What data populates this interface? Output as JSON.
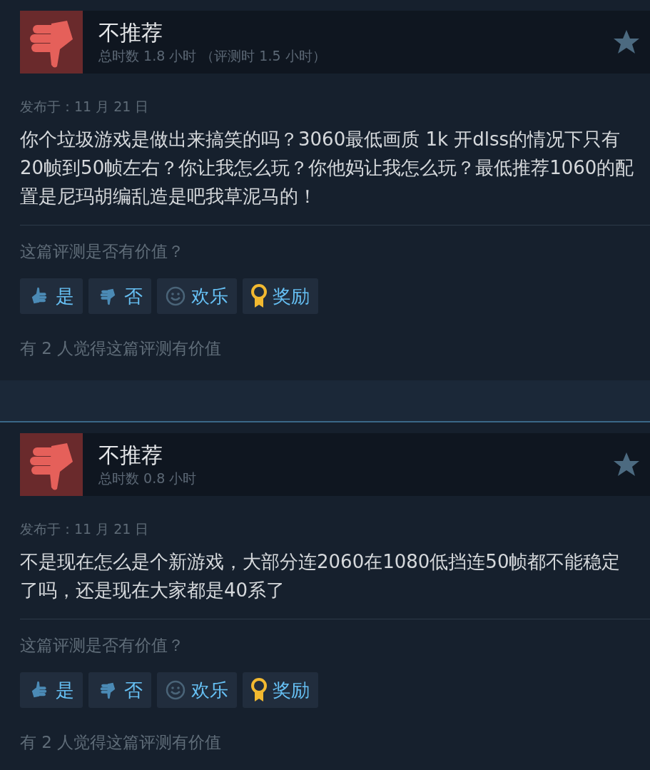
{
  "reviews": [
    {
      "recommended": false,
      "title": "不推荐",
      "hours": "总时数 1.8 小时 （评测时 1.5 小时）",
      "date": "发布于：11 月 21 日",
      "body": "你个垃圾游戏是做出来搞笑的吗？3060最低画质 1k 开dlss的情况下只有20帧到50帧左右？你让我怎么玩？你他妈让我怎么玩？最低推荐1060的配置是尼玛胡编乱造是吧我草泥马的！",
      "question": "这篇评测是否有价值？",
      "buttons": [
        {
          "kind": "yes",
          "label": "是"
        },
        {
          "kind": "no",
          "label": "否"
        },
        {
          "kind": "funny",
          "label": "欢乐"
        },
        {
          "kind": "award",
          "label": "奖励"
        }
      ],
      "helpful": "有 2 人觉得这篇评测有价值"
    },
    {
      "recommended": false,
      "title": "不推荐",
      "hours": "总时数 0.8 小时",
      "date": "发布于：11 月 21 日",
      "body": "不是现在怎么是个新游戏，大部分连2060在1080低挡连50帧都不能稳定了吗，还是现在大家都是40系了",
      "question": "这篇评测是否有价值？",
      "buttons": [
        {
          "kind": "yes",
          "label": "是"
        },
        {
          "kind": "no",
          "label": "否"
        },
        {
          "kind": "funny",
          "label": "欢乐"
        },
        {
          "kind": "award",
          "label": "奖励"
        }
      ],
      "helpful": "有 2 人觉得这篇评测有价值"
    }
  ]
}
